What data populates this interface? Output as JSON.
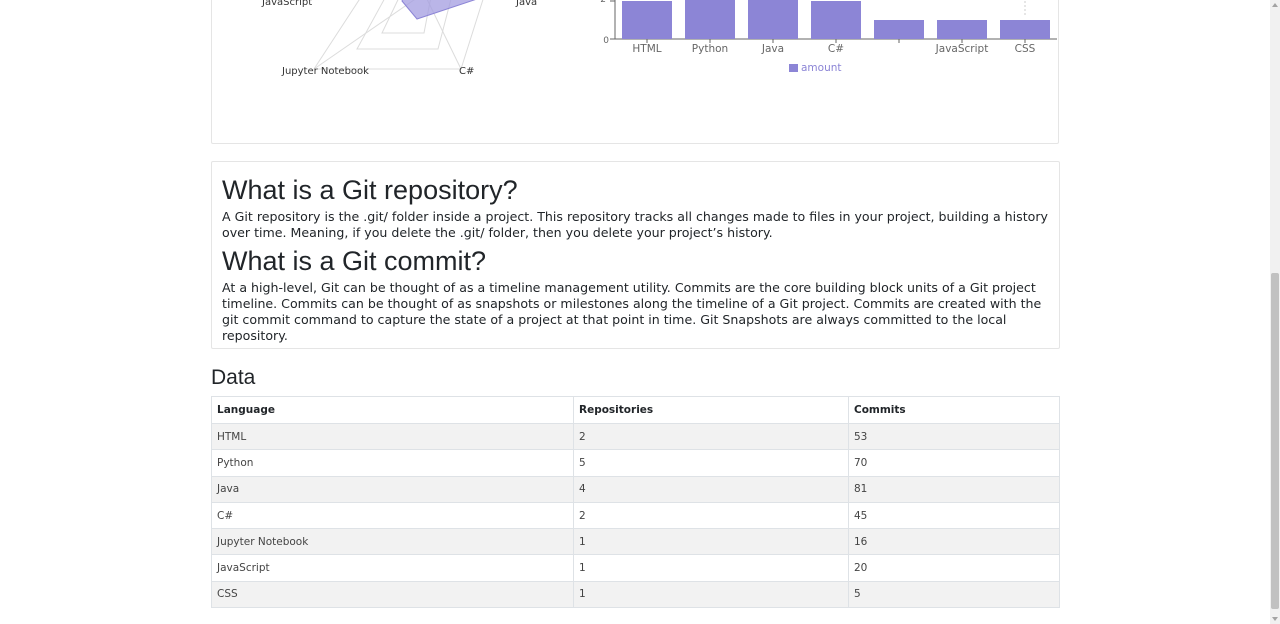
{
  "radar_chart": {
    "visible_labels": [
      "JavaScript",
      "Java",
      "Jupyter Notebook",
      "C#"
    ]
  },
  "chart_data": [
    {
      "type": "bar",
      "categories": [
        "HTML",
        "Python",
        "Java",
        "C#",
        "Jupyter Notebook",
        "JavaScript",
        "CSS"
      ],
      "visible_tick_labels": [
        "HTML",
        "Python",
        "Java",
        "C#",
        "",
        "JavaScript",
        "CSS"
      ],
      "series": [
        {
          "name": "amount",
          "values": [
            2,
            5,
            4,
            2,
            1,
            1,
            1
          ],
          "color": "#8c85d6"
        }
      ],
      "y_ticks_visible": [
        "2",
        "0"
      ],
      "legend": "bottom-center"
    }
  ],
  "sections": [
    {
      "title": "What is a Git repository?",
      "body": "A Git repository is the .git/ folder inside a project. This repository tracks all changes made to files in your project, building a history over time. Meaning, if you delete the .git/ folder, then you delete your project’s history."
    },
    {
      "title": "What is a Git commit?",
      "body": "At a high-level, Git can be thought of as a timeline management utility. Commits are the core building block units of a Git project timeline. Commits can be thought of as snapshots or milestones along the timeline of a Git project. Commits are created with the git commit command to capture the state of a project at that point in time. Git Snapshots are always committed to the local repository."
    }
  ],
  "data_section": {
    "heading": "Data",
    "columns": [
      "Language",
      "Repositories",
      "Commits"
    ],
    "rows": [
      [
        "HTML",
        "2",
        "53"
      ],
      [
        "Python",
        "5",
        "70"
      ],
      [
        "Java",
        "4",
        "81"
      ],
      [
        "C#",
        "2",
        "45"
      ],
      [
        "Jupyter Notebook",
        "1",
        "16"
      ],
      [
        "JavaScript",
        "1",
        "20"
      ],
      [
        "CSS",
        "1",
        "5"
      ]
    ]
  }
}
